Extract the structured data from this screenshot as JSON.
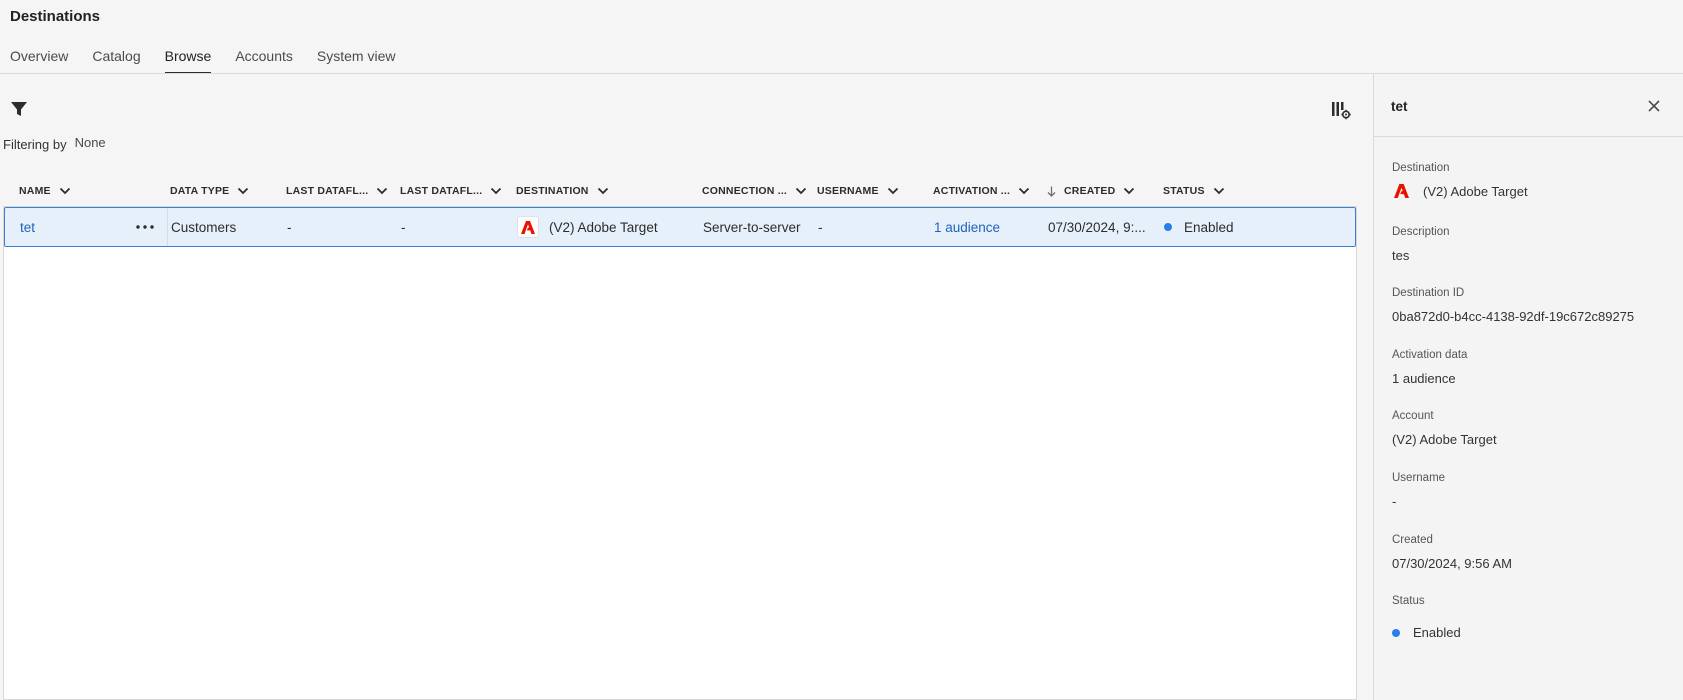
{
  "app": {
    "title": "Destinations"
  },
  "tabs": [
    {
      "label": "Overview"
    },
    {
      "label": "Catalog"
    },
    {
      "label": "Browse",
      "active": true
    },
    {
      "label": "Accounts"
    },
    {
      "label": "System view"
    }
  ],
  "toolbar": {
    "filter_icon": "filter-icon",
    "column_settings_icon": "column-settings-icon",
    "filtering_label": "Filtering by",
    "filtering_value": "None"
  },
  "table": {
    "columns": [
      {
        "label": "NAME"
      },
      {
        "label": "DATA TYPE"
      },
      {
        "label": "LAST DATAFL..."
      },
      {
        "label": "LAST DATAFL..."
      },
      {
        "label": "DESTINATION"
      },
      {
        "label": "CONNECTION ..."
      },
      {
        "label": "USERNAME"
      },
      {
        "label": "ACTIVATION ..."
      },
      {
        "label": "CREATED",
        "sorted": "descending"
      },
      {
        "label": "STATUS"
      }
    ],
    "rows": [
      {
        "name": "tet",
        "data_type": "Customers",
        "last_dataflow_1": "-",
        "last_dataflow_2": "-",
        "destination": "(V2) Adobe Target",
        "connection": "Server-to-server",
        "username": "-",
        "activation": "1 audience",
        "created": "07/30/2024, 9:...",
        "status": "Enabled",
        "selected": true
      }
    ]
  },
  "panel": {
    "title": "tet",
    "fields": {
      "destination": {
        "label": "Destination",
        "value": "(V2) Adobe Target"
      },
      "description": {
        "label": "Description",
        "value": "tes"
      },
      "destination_id": {
        "label": "Destination ID",
        "value": "0ba872d0-b4cc-4138-92df-19c672c89275"
      },
      "activation_data": {
        "label": "Activation data",
        "value": "1 audience"
      },
      "account": {
        "label": "Account",
        "value": "(V2) Adobe Target"
      },
      "username": {
        "label": "Username",
        "value": "-"
      },
      "created": {
        "label": "Created",
        "value": "07/30/2024, 9:56 AM"
      },
      "status": {
        "label": "Status",
        "value": "Enabled"
      }
    }
  },
  "colors": {
    "accent": "#2680eb",
    "link": "#1f62b8",
    "adobe_red": "#eb1000",
    "row_selected_bg": "#e6f0fb",
    "row_selected_border": "#3b7fd3"
  }
}
